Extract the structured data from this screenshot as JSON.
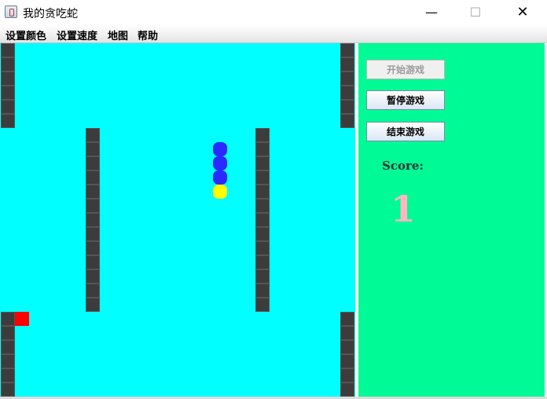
{
  "window": {
    "title": "我的贪吃蛇",
    "minimize_glyph": "—",
    "maximize_glyph": "☐",
    "close_glyph": "✕"
  },
  "menu": {
    "items": [
      "设置颜色",
      "设置速度",
      "地图",
      "帮助"
    ]
  },
  "board": {
    "background": "#00ffff",
    "wall_color": "#3c3c3c",
    "snake": {
      "body_color": "#2a2aff",
      "head_color": "#ffff00",
      "body_segments": 3,
      "head_direction": "down"
    },
    "food": {
      "color": "#ff0000"
    }
  },
  "panel": {
    "background": "#00fa96",
    "buttons": [
      {
        "label": "开始游戏",
        "enabled": false
      },
      {
        "label": "暂停游戏",
        "enabled": true
      },
      {
        "label": "结束游戏",
        "enabled": true
      }
    ],
    "score_label": "Score:",
    "score_value": "1",
    "score_color": "#ffb6c1"
  }
}
